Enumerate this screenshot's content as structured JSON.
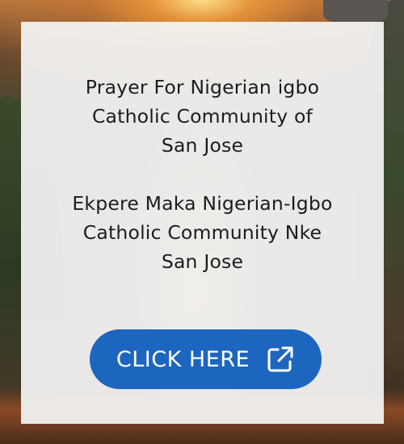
{
  "english_prayer_title": {
    "lines": [
      "Prayer For Nigerian igbo",
      "Catholic Community of",
      "San Jose"
    ]
  },
  "igbo_prayer_title": {
    "lines": [
      "Ekpere Maka Nigerian-Igbo",
      "Catholic Community Nke",
      "San Jose"
    ]
  },
  "cta_button": {
    "label": "CLICK HERE",
    "icon": "external-link-icon",
    "color": "#1d66c0",
    "text_color": "#ffffff"
  },
  "colors": {
    "card_background": "#f5f5f5",
    "text": "#1c1c1c"
  }
}
